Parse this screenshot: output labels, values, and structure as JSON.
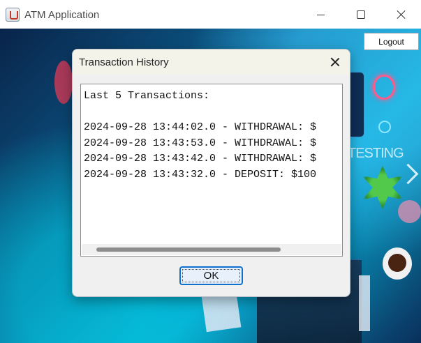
{
  "window": {
    "title": "ATM Application",
    "icon": "java-cup-icon"
  },
  "toolbar": {
    "logout_label": "Logout"
  },
  "background": {
    "banner_text": "TESTING"
  },
  "dialog": {
    "title": "Transaction History",
    "header_line": "Last 5 Transactions:",
    "transactions": [
      "2024-09-28 13:44:02.0 - WITHDRAWAL: $",
      "2024-09-28 13:43:53.0 - WITHDRAWAL: $",
      "2024-09-28 13:43:42.0 - WITHDRAWAL: $",
      "2024-09-28 13:43:32.0 - DEPOSIT: $100"
    ],
    "ok_label": "OK"
  }
}
